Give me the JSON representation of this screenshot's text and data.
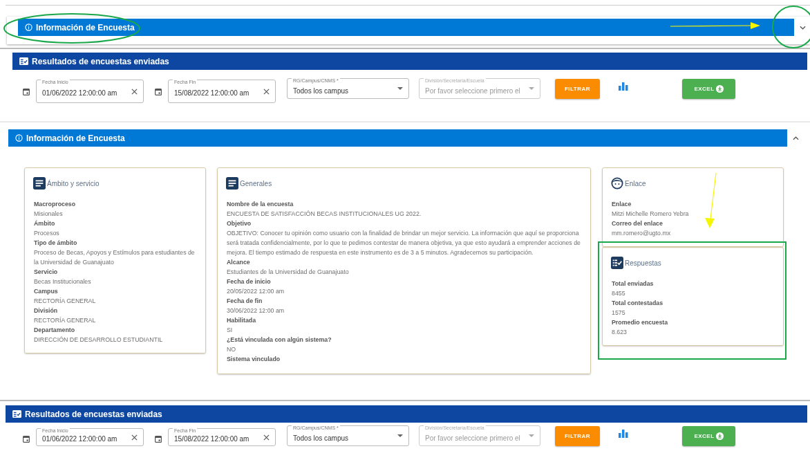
{
  "sections": [
    {
      "kind": "info",
      "title": "Información de Encuesta",
      "expanded": false
    },
    {
      "kind": "results",
      "title": "Resultados de encuestas enviadas",
      "fields": [
        {
          "kind": "date",
          "label": "Fecha Inicio",
          "value": "01/06/2022 12:00:00 am"
        },
        {
          "kind": "date",
          "label": "Fecha Fin",
          "value": "15/08/2022 12:00:00 am"
        },
        {
          "kind": "select",
          "label": "RG/Campus/CNMS *",
          "value": "Todos los campus",
          "disabled": false
        },
        {
          "kind": "select",
          "label": "División/Secretaría/Escuela",
          "placeholder": "Por favor seleccione primero el",
          "disabled": true
        }
      ],
      "filter_button": "FILTRAR",
      "excel_button": "EXCEL"
    },
    {
      "kind": "info",
      "title": "Información de Encuesta",
      "expanded": true,
      "columns": [
        [
          {
            "kind": "list",
            "title": "Ámbito y servicio",
            "fields": [
              {
                "label": "Macroproceso",
                "value": "Misionales"
              },
              {
                "label": "Ámbito",
                "value": "Procesos"
              },
              {
                "label": "Tipo de ámbito",
                "value": "Proceso de Becas, Apoyos y Estímulos para estudiantes de la Universidad de Guanajuato"
              },
              {
                "label": "Servicio",
                "value": "Becas Institucionales"
              },
              {
                "label": "Campus",
                "value": "RECTORÍA GENERAL"
              },
              {
                "label": "División",
                "value": "RECTORÍA GENERAL"
              },
              {
                "label": "Departamento",
                "value": "DIRECCIÓN DE DESARROLLO ESTUDIANTIL"
              }
            ]
          }
        ],
        [
          {
            "kind": "list",
            "title": "Generales",
            "fields": [
              {
                "label": "Nombre de la encuesta",
                "value": "ENCUESTA DE SATISFACCIÓN BECAS INSTITUCIONALES UG 2022."
              },
              {
                "label": "Objetivo",
                "value": "OBJETIVO: Conocer tu opinión como usuario con la finalidad de brindar un mejor servicio. La información que aquí se proporciona será tratada confidencialmente, por lo que te pedimos contestar de manera objetiva, ya que esto ayudará a emprender acciones de mejora. El tiempo estimado de respuesta en este instrumento es de 3 a 5 minutos. Agradecemos su participación."
              },
              {
                "label": "Alcance",
                "value": "Estudiantes de la Universidad de Guanajuato"
              },
              {
                "label": "Fecha de inicio",
                "value": "20/05/2022 12:00 am"
              },
              {
                "label": "Fecha de fin",
                "value": "30/06/2022 12:00 am"
              },
              {
                "label": "Habilitada",
                "value": "SI"
              },
              {
                "label": "¿Está vinculada con algún sistema?",
                "value": "NO"
              },
              {
                "label": "Sistema vinculado"
              }
            ]
          }
        ],
        [
          {
            "kind": "person",
            "title": "Enlace",
            "fields": [
              {
                "label": "Enlace",
                "value": "Mitzi Michelle Romero Yebra"
              },
              {
                "label": "Correo del enlace",
                "value": "mm.romero@ugto.mx"
              }
            ]
          },
          {
            "kind": "checklist",
            "title": "Respuestas",
            "fields": [
              {
                "label": "Total enviadas",
                "value": "8455"
              },
              {
                "label": "Total contestadas",
                "value": "1575"
              },
              {
                "label": "Promedio encuesta",
                "value": "8.623"
              }
            ]
          }
        ]
      ]
    },
    {
      "kind": "results",
      "title": "Resultados de encuestas enviadas",
      "fields": [
        {
          "kind": "date",
          "label": "Fecha Inicio",
          "value": "01/06/2022 12:00:00 am"
        },
        {
          "kind": "date",
          "label": "Fecha Fin",
          "value": "15/08/2022 12:00:00 am"
        },
        {
          "kind": "select",
          "label": "RG/Campus/CNMS *",
          "value": "Todos los campus",
          "disabled": false
        },
        {
          "kind": "select",
          "label": "División/Secretaría/Escuela",
          "placeholder": "Por favor seleccione primero el",
          "disabled": true
        }
      ],
      "filter_button": "FILTRAR",
      "excel_button": "EXCEL"
    }
  ]
}
